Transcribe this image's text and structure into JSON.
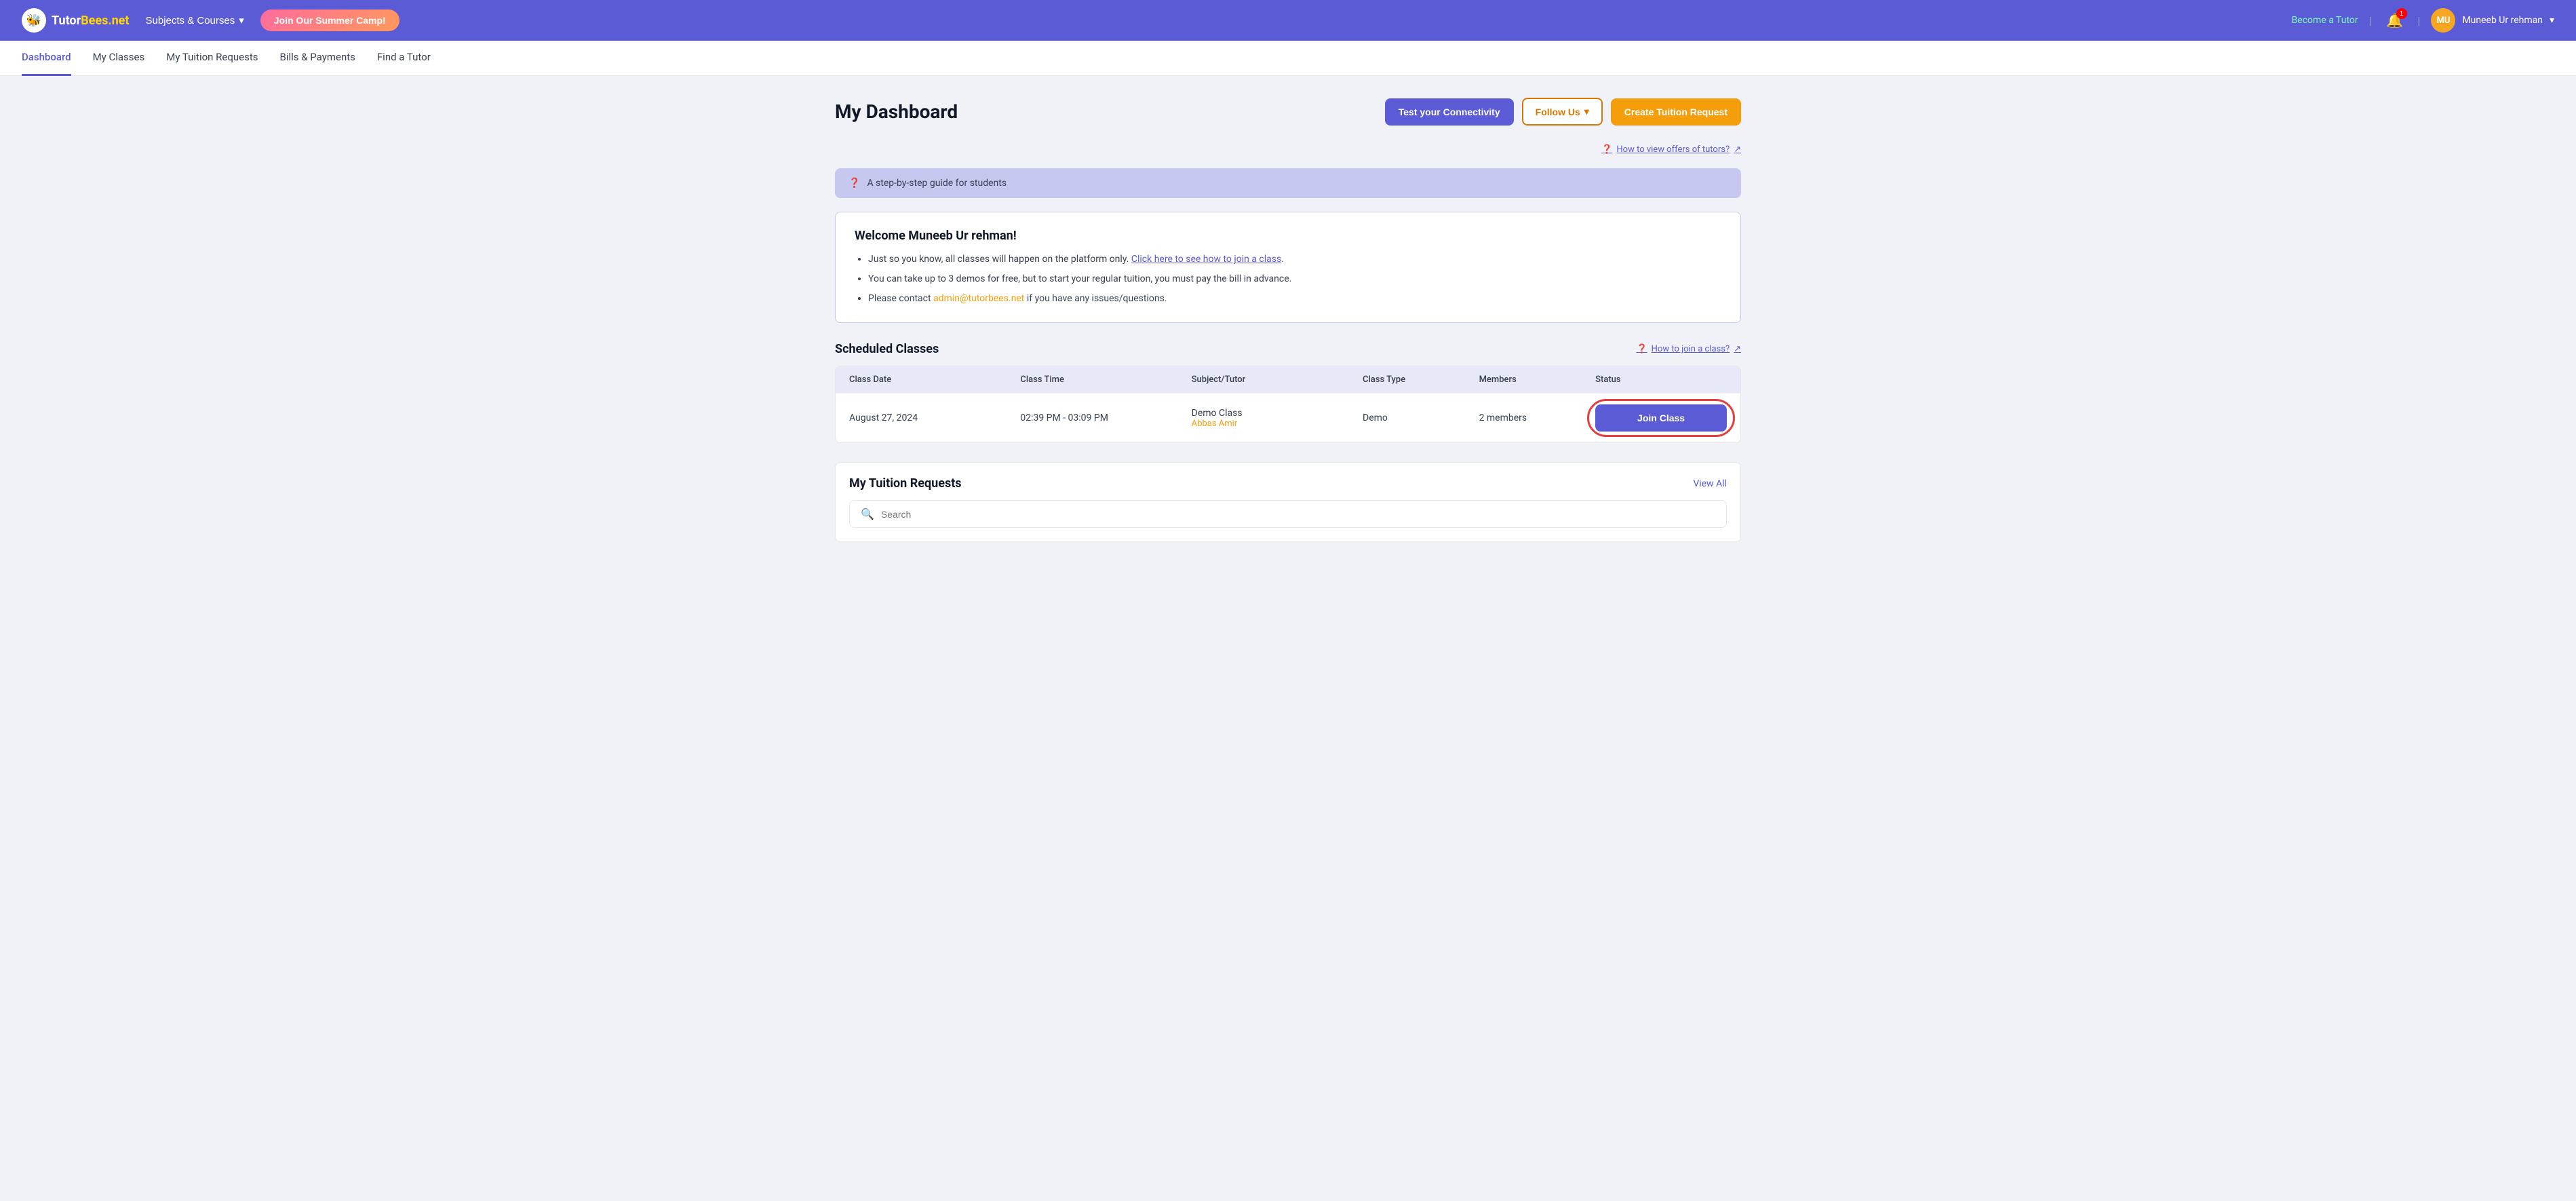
{
  "logo": {
    "name": "TutorBees",
    "domain": ".net",
    "icon": "🐝"
  },
  "topnav": {
    "subjects_label": "Subjects & Courses",
    "summer_camp_label": "Join Our Summer Camp!",
    "become_tutor_label": "Become a Tutor",
    "notification_count": "1",
    "user_initials": "MU",
    "user_name": "Muneeb Ur rehman",
    "chevron": "▾"
  },
  "secondarynav": {
    "items": [
      {
        "label": "Dashboard",
        "active": true
      },
      {
        "label": "My Classes",
        "active": false
      },
      {
        "label": "My Tuition Requests",
        "active": false
      },
      {
        "label": "Bills & Payments",
        "active": false
      },
      {
        "label": "Find a Tutor",
        "active": false
      }
    ]
  },
  "dashboard": {
    "title": "My Dashboard",
    "connectivity_btn": "Test your Connectivity",
    "follow_us_btn": "Follow Us",
    "follow_chevron": "▾",
    "create_tuition_btn": "Create Tuition Request",
    "help_link": "How to view offers of tutors?",
    "external_icon": "↗"
  },
  "guide_banner": {
    "icon": "❓",
    "text": "A step-by-step guide for students"
  },
  "welcome": {
    "title": "Welcome Muneeb Ur rehman!",
    "bullet1_prefix": "Just so you know, all classes will happen on the platform only.",
    "bullet1_link": "Click here to see how to join a class",
    "bullet1_suffix": ".",
    "bullet2": "You can take up to 3 demos for free, but to start your regular tuition, you must pay the bill in advance.",
    "bullet3_prefix": "Please contact",
    "bullet3_email": "admin@tutorbees.net",
    "bullet3_suffix": "if you have any issues/questions."
  },
  "scheduled_classes": {
    "title": "Scheduled Classes",
    "help_link": "How to join a class?",
    "external_icon": "↗",
    "columns": [
      "Class Date",
      "Class Time",
      "Subject/Tutor",
      "Class Type",
      "Members",
      "Status"
    ],
    "rows": [
      {
        "date": "August 27, 2024",
        "time": "02:39 PM - 03:09 PM",
        "subject": "Demo Class",
        "tutor": "Abbas Amir",
        "type": "Demo",
        "members": "2 members",
        "action": "Join Class"
      }
    ]
  },
  "tuition_requests": {
    "title": "My Tuition Requests",
    "view_all": "View All",
    "search_placeholder": "Search"
  }
}
